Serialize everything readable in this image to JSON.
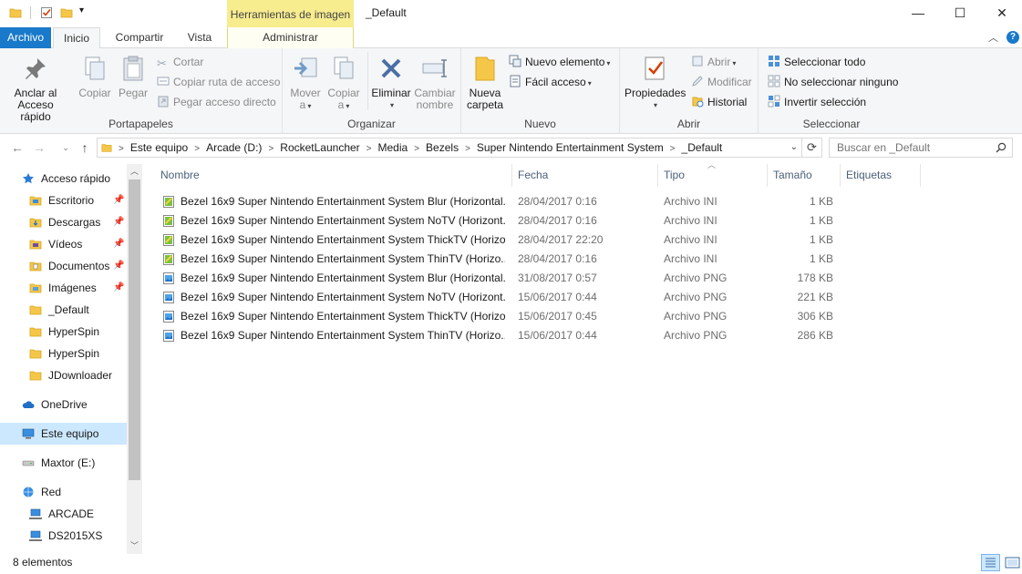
{
  "window": {
    "title": "_Default",
    "context_tab_header": "Herramientas de imagen",
    "controls": {
      "minimize": "—",
      "maximize": "☐",
      "close": "✕"
    }
  },
  "quick_access_toolbar": {
    "icons": [
      "folder-icon",
      "properties-icon",
      "new-folder-icon"
    ],
    "dropdown": "▾"
  },
  "ribbon_tabs": {
    "archivo": "Archivo",
    "inicio": "Inicio",
    "compartir": "Compartir",
    "vista": "Vista",
    "administrar": "Administrar",
    "collapse": "︿",
    "help": "?"
  },
  "ribbon": {
    "portapapeles": {
      "label": "Portapapeles",
      "anclar": [
        "Anclar al",
        "Acceso rápido"
      ],
      "copiar": "Copiar",
      "pegar": "Pegar",
      "cortar": "Cortar",
      "copiar_ruta": "Copiar ruta de acceso",
      "pegar_acceso": "Pegar acceso directo"
    },
    "organizar": {
      "label": "Organizar",
      "mover": [
        "Mover",
        "a"
      ],
      "copiar": [
        "Copiar",
        "a"
      ],
      "eliminar": "Eliminar",
      "cambiar": [
        "Cambiar",
        "nombre"
      ]
    },
    "nuevo": {
      "label": "Nuevo",
      "nueva_carpeta": [
        "Nueva",
        "carpeta"
      ],
      "nuevo_elemento": "Nuevo elemento",
      "facil_acceso": "Fácil acceso"
    },
    "abrir": {
      "label": "Abrir",
      "propiedades": "Propiedades",
      "abrir": "Abrir",
      "modificar": "Modificar",
      "historial": "Historial"
    },
    "seleccionar": {
      "label": "Seleccionar",
      "todo": "Seleccionar todo",
      "ninguno": "No seleccionar ninguno",
      "invertir": "Invertir selección"
    }
  },
  "address": {
    "crumbs": [
      "Este equipo",
      "Arcade (D:)",
      "RocketLauncher",
      "Media",
      "Bezels",
      "Super Nintendo Entertainment System",
      "_Default"
    ],
    "separator": ">",
    "search_placeholder": "Buscar en _Default"
  },
  "nav": {
    "items": [
      {
        "label": "Acceso rápido",
        "icon": "star-icon",
        "pinned": false
      },
      {
        "label": "Escritorio",
        "icon": "desktop-folder-icon",
        "pinned": true
      },
      {
        "label": "Descargas",
        "icon": "downloads-folder-icon",
        "pinned": true
      },
      {
        "label": "Vídeos",
        "icon": "videos-folder-icon",
        "pinned": true
      },
      {
        "label": "Documentos",
        "icon": "documents-folder-icon",
        "pinned": true
      },
      {
        "label": "Imágenes",
        "icon": "pictures-folder-icon",
        "pinned": true
      },
      {
        "label": "_Default",
        "icon": "folder-icon",
        "pinned": false
      },
      {
        "label": "HyperSpin",
        "icon": "folder-icon",
        "pinned": false
      },
      {
        "label": "HyperSpin",
        "icon": "folder-icon",
        "pinned": false
      },
      {
        "label": "JDownloader",
        "icon": "folder-icon",
        "pinned": false
      },
      {
        "label": "OneDrive",
        "icon": "onedrive-icon",
        "pinned": false
      },
      {
        "label": "Este equipo",
        "icon": "computer-icon",
        "pinned": false,
        "selected": true
      },
      {
        "label": "Maxtor (E:)",
        "icon": "drive-icon",
        "pinned": false
      },
      {
        "label": "Red",
        "icon": "network-icon",
        "pinned": false
      },
      {
        "label": "ARCADE",
        "icon": "network-computer-icon",
        "pinned": false
      },
      {
        "label": "DS2015XS",
        "icon": "network-computer-icon",
        "pinned": false
      }
    ],
    "pin_glyph": "📌"
  },
  "columns": {
    "nombre": "Nombre",
    "fecha": "Fecha",
    "tipo": "Tipo",
    "tamano": "Tamaño",
    "etiquetas": "Etiquetas",
    "sort_indicator": "︿"
  },
  "files": [
    {
      "name": "Bezel 16x9 Super Nintendo Entertainment System Blur (Horizontal...",
      "date": "28/04/2017 0:16",
      "type": "Archivo INI",
      "size": "1 KB",
      "icon": "ini-file-icon"
    },
    {
      "name": "Bezel 16x9 Super Nintendo Entertainment System NoTV (Horizont...",
      "date": "28/04/2017 0:16",
      "type": "Archivo INI",
      "size": "1 KB",
      "icon": "ini-file-icon"
    },
    {
      "name": "Bezel 16x9 Super Nintendo Entertainment System ThickTV (Horizo...",
      "date": "28/04/2017 22:20",
      "type": "Archivo INI",
      "size": "1 KB",
      "icon": "ini-file-icon"
    },
    {
      "name": "Bezel 16x9 Super Nintendo Entertainment System ThinTV (Horizo...",
      "date": "28/04/2017 0:16",
      "type": "Archivo INI",
      "size": "1 KB",
      "icon": "ini-file-icon"
    },
    {
      "name": "Bezel 16x9 Super Nintendo Entertainment System Blur (Horizontal...",
      "date": "31/08/2017 0:57",
      "type": "Archivo PNG",
      "size": "178 KB",
      "icon": "png-file-icon"
    },
    {
      "name": "Bezel 16x9 Super Nintendo Entertainment System NoTV (Horizont...",
      "date": "15/06/2017 0:44",
      "type": "Archivo PNG",
      "size": "221 KB",
      "icon": "png-file-icon"
    },
    {
      "name": "Bezel 16x9 Super Nintendo Entertainment System ThickTV (Horizo...",
      "date": "15/06/2017 0:45",
      "type": "Archivo PNG",
      "size": "306 KB",
      "icon": "png-file-icon"
    },
    {
      "name": "Bezel 16x9 Super Nintendo Entertainment System ThinTV (Horizo...",
      "date": "15/06/2017 0:44",
      "type": "Archivo PNG",
      "size": "286 KB",
      "icon": "png-file-icon"
    }
  ],
  "status": {
    "count": "8 elementos"
  },
  "colors": {
    "accent": "#1979ca",
    "context_tab": "#f7ec8e",
    "selection": "#cce8ff",
    "header_text": "#4c607a"
  }
}
